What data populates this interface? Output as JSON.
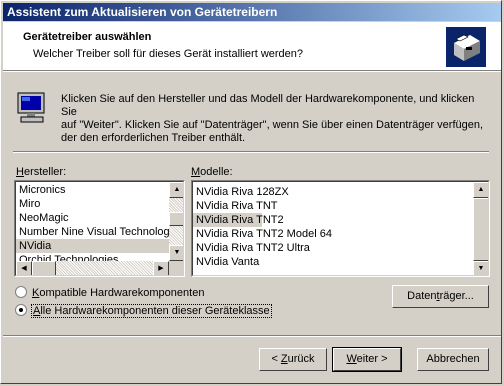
{
  "window": {
    "title": "Assistent zum Aktualisieren von Gerätetreibern"
  },
  "header": {
    "title": "Gerätetreiber auswählen",
    "subtitle": "Welcher Treiber soll für dieses Gerät installiert werden?"
  },
  "intro": {
    "line1": "Klicken Sie auf den Hersteller und das Modell der Hardwarekomponente, und klicken Sie",
    "line2": "auf \"Weiter\". Klicken Sie auf \"Datenträger\", wenn Sie über einen Datenträger verfügen,",
    "line3": "der den erforderlichen Treiber enthält."
  },
  "manufacturers": {
    "label_prefix": "",
    "label_hotkey": "H",
    "label_rest": "ersteller:",
    "items": [
      "Micronics",
      "Miro",
      "NeoMagic",
      "Number Nine Visual Technolog",
      "NVidia",
      "Orchid Technologies"
    ],
    "selected": "NVidia"
  },
  "models": {
    "label_hotkey": "M",
    "label_rest": "odelle:",
    "items": [
      "NVidia Riva 128ZX",
      "NVidia Riva TNT",
      "NVidia Riva TNT2",
      "NVidia Riva TNT2 Model 64",
      "NVidia Riva TNT2 Ultra",
      "NVidia Vanta"
    ],
    "selected": "NVidia Riva TNT2"
  },
  "options": {
    "compatible_hotkey": "K",
    "compatible_rest": "ompatible Hardwarekomponenten",
    "all_hotkey": "A",
    "all_rest": "lle Hardwarekomponenten dieser Geräteklasse",
    "selected": "all"
  },
  "buttons": {
    "disk_pre": "Daten",
    "disk_hotkey": "t",
    "disk_post": "räger...",
    "back_pre": "< ",
    "back_hotkey": "Z",
    "back_post": "urück",
    "next_hotkey": "W",
    "next_post": "eiter >",
    "cancel": "Abbrechen"
  },
  "colors": {
    "title_start": "#0a246a",
    "title_end": "#a6caf0",
    "face": "#d4d0c8"
  }
}
